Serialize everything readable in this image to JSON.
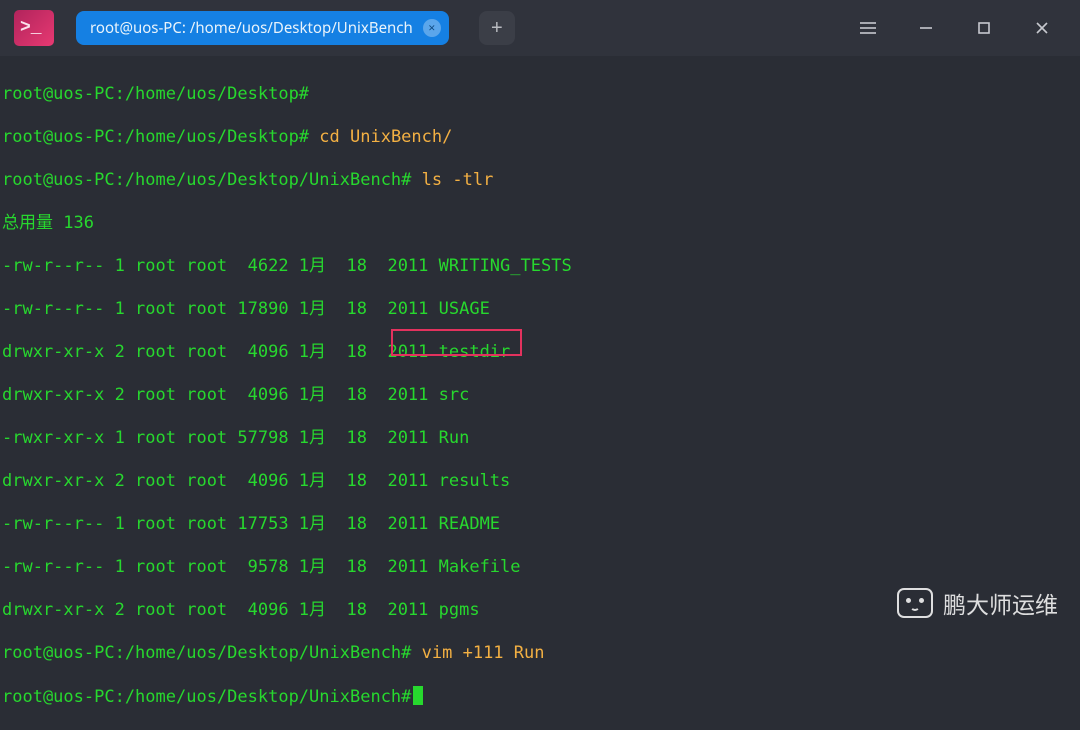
{
  "titlebar": {
    "app_icon_glyph": ">_",
    "tab_title": "root@uos-PC: /home/uos/Desktop/UnixBench",
    "tab_close_glyph": "×",
    "new_tab_glyph": "+"
  },
  "terminal": {
    "prompt_short": "root@uos-PC:/home/uos/Desktop#",
    "prompt_long": "root@uos-PC:/home/uos/Desktop/UnixBench#",
    "cmd_cd": "cd UnixBench/",
    "cmd_ls": "ls -tlr",
    "total_line": "总用量 136",
    "listing": [
      "-rw-r--r-- 1 root root  4622 1月  18  2011 WRITING_TESTS",
      "-rw-r--r-- 1 root root 17890 1月  18  2011 USAGE",
      "drwxr-xr-x 2 root root  4096 1月  18  2011 testdir",
      "drwxr-xr-x 2 root root  4096 1月  18  2011 src",
      "-rwxr-xr-x 1 root root 57798 1月  18  2011 Run",
      "drwxr-xr-x 2 root root  4096 1月  18  2011 results",
      "-rw-r--r-- 1 root root 17753 1月  18  2011 README",
      "-rw-r--r-- 1 root root  9578 1月  18  2011 Makefile",
      "drwxr-xr-x 2 root root  4096 1月  18  2011 pgms"
    ],
    "cmd_vim": "vim +111 Run"
  },
  "watermark": {
    "text": "鹏大师运维"
  }
}
